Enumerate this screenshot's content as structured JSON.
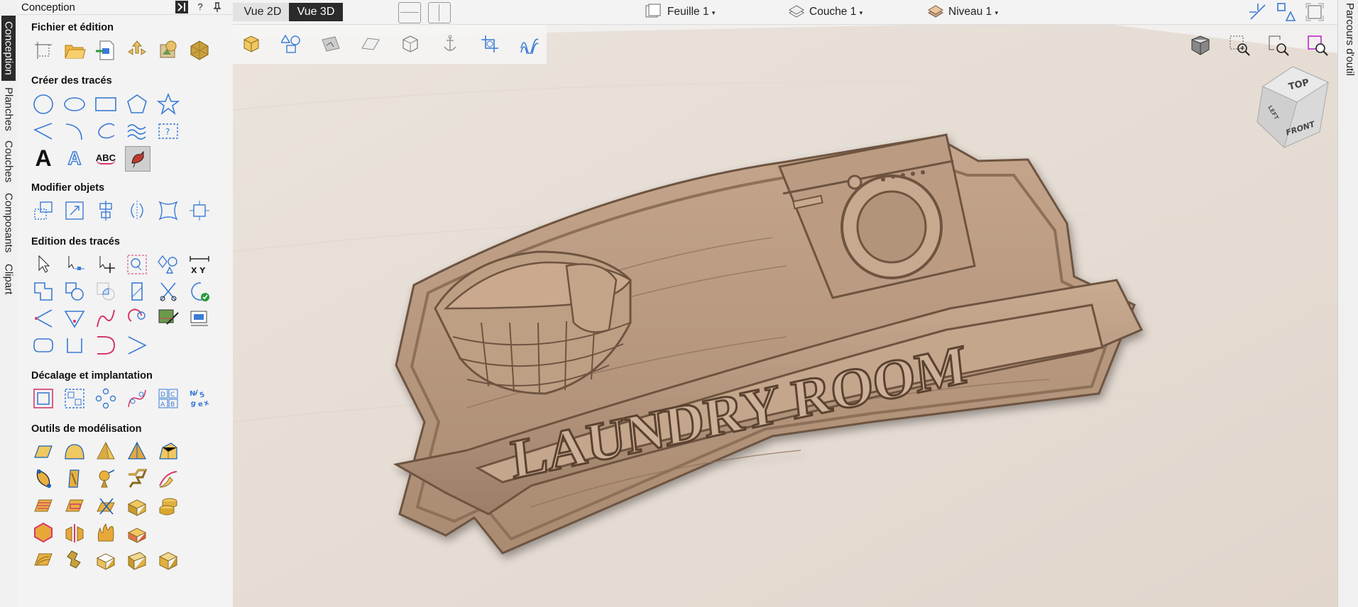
{
  "vertical_tabs": [
    "Conception",
    "Planches",
    "Couches",
    "Composants",
    "Clipart"
  ],
  "panel": {
    "title": "Conception",
    "help": "?",
    "sections": {
      "file": "Fichier et édition",
      "create": "Créer des tracés",
      "modify": "Modifier objets",
      "edit": "Edition des tracés",
      "offset": "Décalage et implantation",
      "model": "Outils de modélisation"
    }
  },
  "text_tools": {
    "text": "A",
    "auto_text": "A",
    "arc_text": "ABC"
  },
  "xy_label": "X  Y",
  "dims_label": "D C\nA B",
  "topbar": {
    "view2d": "Vue 2D",
    "view3d": "Vue 3D",
    "sheet": "Feuille 1",
    "layer": "Couche 1",
    "level": "Niveau 1"
  },
  "right_panel": "Parcours d'outil",
  "viewcube": {
    "top": "TOP",
    "front": "FRONT",
    "left": "LEFT"
  },
  "model": {
    "title": "LAUNDRY ROOM"
  },
  "colors": {
    "accent": "#3a7bd5",
    "dark": "#2b2b2b",
    "wood": "#b99a80",
    "gold": "#e8c06a"
  }
}
